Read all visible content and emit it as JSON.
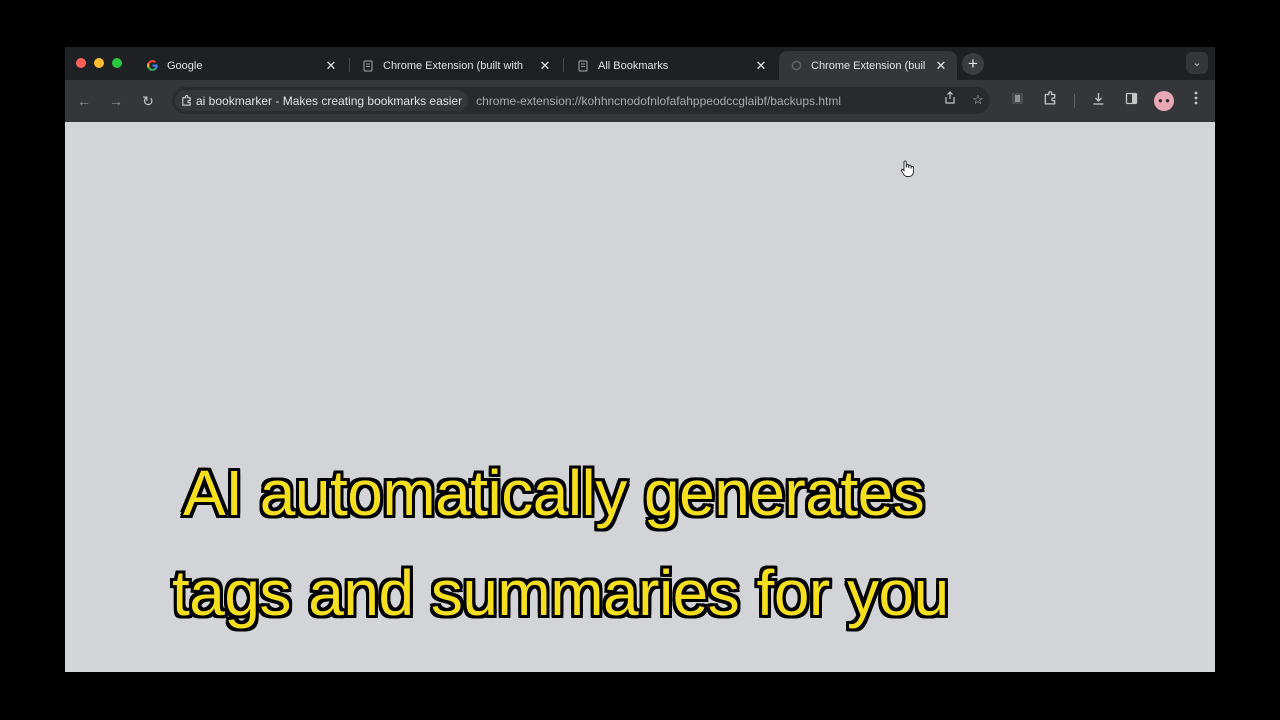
{
  "window": {
    "traffic_lights": {
      "close_color": "#ff5f57",
      "minimize_color": "#febc2e",
      "maximize_color": "#28c840"
    }
  },
  "tabs": [
    {
      "title": "Google",
      "favicon": "google-g-icon",
      "active": false
    },
    {
      "title": "Chrome Extension (built with",
      "favicon": "page-icon",
      "active": false
    },
    {
      "title": "All Bookmarks",
      "favicon": "page-icon",
      "active": false
    },
    {
      "title": "Chrome Extension (buil",
      "favicon": "loading-icon",
      "active": true
    }
  ],
  "tab_controls": {
    "close_symbol": "✕",
    "new_tab_symbol": "+",
    "tab_search_symbol": "⌄"
  },
  "toolbar": {
    "back_symbol": "←",
    "forward_symbol": "→",
    "reload_symbol": "↻",
    "site_chip": "ai bookmarker - Makes creating bookmarks easier",
    "url": "chrome-extension://kohhncnodofnlofafahppeodccglaibf/backups.html",
    "share_icon": "share-icon",
    "bookmark_icon": "star-icon",
    "extension_icons": [
      "bookmarker-extension-icon",
      "puzzle-icon"
    ],
    "download_icon": "download-icon",
    "side_panel_icon": "side-panel-icon",
    "menu_icon": "kebab-menu-icon",
    "avatar_text": "● ●"
  },
  "page": {
    "background": "#d2d4d7"
  },
  "caption": {
    "line1": "AI automatically generates",
    "line2": "tags and summaries for you",
    "color": "#f5df1f",
    "outline_color": "#000000"
  }
}
